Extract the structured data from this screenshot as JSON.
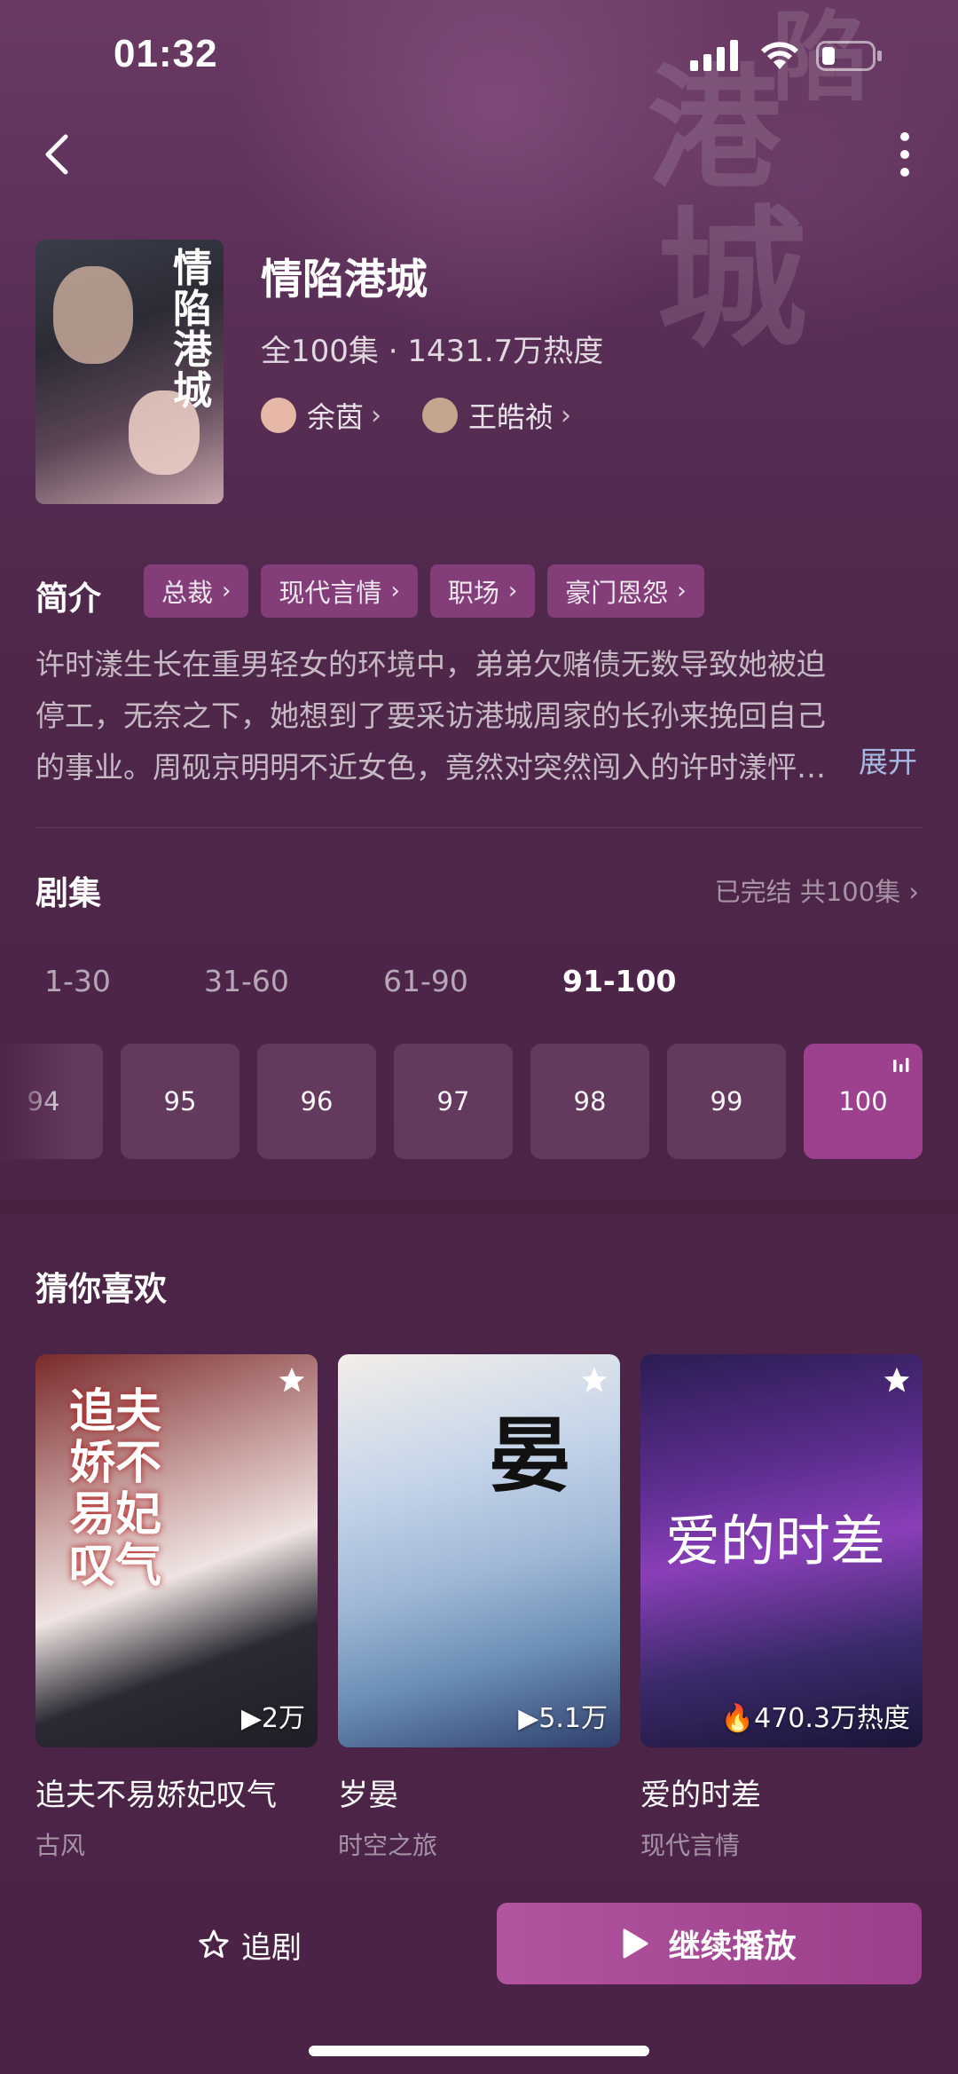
{
  "status_bar": {
    "time": "01:32"
  },
  "drama": {
    "poster_title": "情陷港城",
    "title": "情陷港城",
    "meta": "全100集 · 1431.7万热度",
    "actors": [
      {
        "name": "余茵",
        "avatar_color": "#e7b7a8"
      },
      {
        "name": "王皓祯",
        "avatar_color": "#c6a58e"
      }
    ]
  },
  "intro": {
    "label": "简介",
    "tags": [
      "总裁",
      "现代言情",
      "职场",
      "豪门恩怨"
    ],
    "description": "许时漾生长在重男轻女的环境中，弟弟欠赌债无数导致她被迫停工，无奈之下，她想到了要采访港城周家的长孙来挽回自己的事业。周砚京明明不近女色，竟然对突然闯入的许时漾怦…",
    "expand": "展开"
  },
  "episodes": {
    "label": "剧集",
    "status": "已完结 共100集 ›",
    "ranges": [
      "1-30",
      "31-60",
      "61-90",
      "91-100"
    ],
    "active_range": "91-100",
    "items": [
      "94",
      "95",
      "96",
      "97",
      "98",
      "99",
      "100"
    ],
    "current": "100"
  },
  "recommend": {
    "label": "猜你喜欢",
    "items": [
      {
        "name": "追夫不易娇妃叹气",
        "genre": "古风",
        "views": "2万",
        "cover_text": "追夫娇不易妃叹气"
      },
      {
        "name": "岁晏",
        "genre": "时空之旅",
        "views": "5.1万",
        "cover_text": "晏"
      },
      {
        "name": "爱的时差",
        "genre": "现代言情",
        "views": "470.3万热度",
        "cover_text": "爱的时差"
      }
    ]
  },
  "bottom": {
    "follow_label": "追剧",
    "play_label": "继续播放"
  },
  "colors": {
    "accent": "#9d418f",
    "tag_bg": "#833d78",
    "link": "#a7b9e2"
  }
}
